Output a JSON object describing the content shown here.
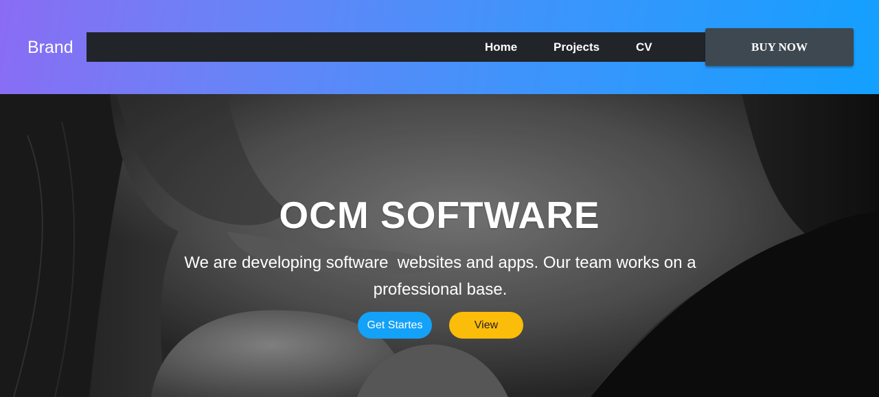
{
  "header": {
    "brand": "Brand",
    "nav": [
      {
        "label": "Home"
      },
      {
        "label": "Projects"
      },
      {
        "label": "CV"
      }
    ],
    "cta": "BUY NOW",
    "gradient_colors": [
      "#8a6cf4",
      "#13a0ff"
    ],
    "navbar_color": "#212429",
    "cta_color": "#3e4850"
  },
  "hero": {
    "title": "OCM SOFTWARE",
    "description": "We are developing software  websites and apps. Our team works on a professional base.",
    "primary_button": "Get Startes",
    "secondary_button": "View",
    "primary_color": "#14a1f8",
    "secondary_color": "#fcbc0a",
    "background_image": "grayscale close-up photo of a face with fingers at the lips"
  }
}
